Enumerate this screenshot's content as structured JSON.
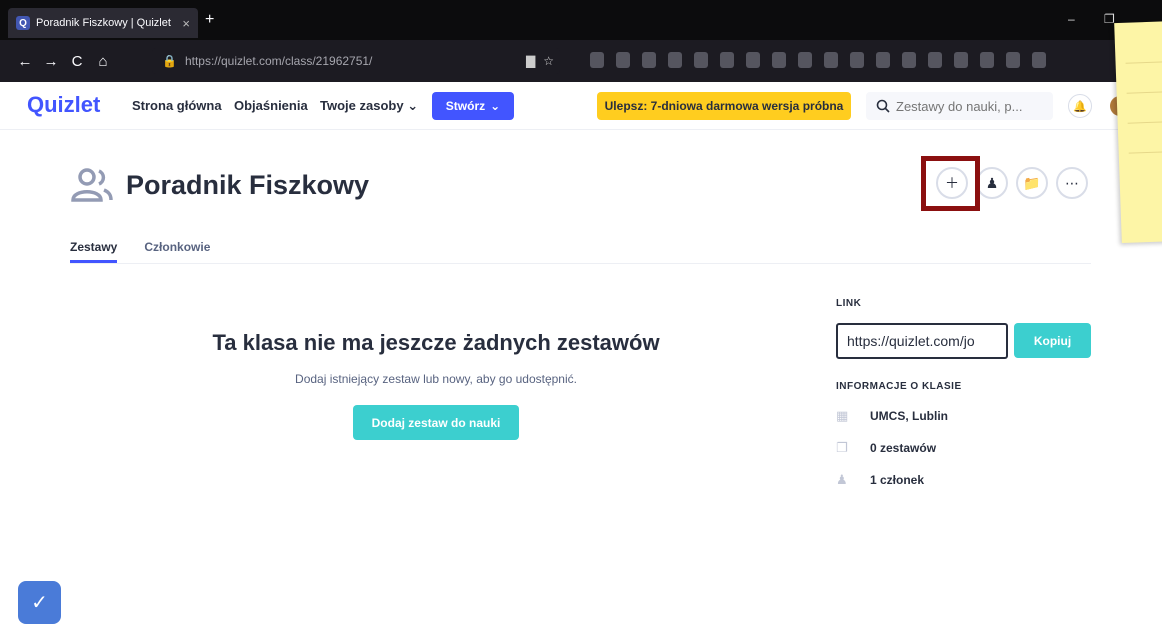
{
  "browser": {
    "tab_title": "Poradnik Fiszkowy | Quizlet",
    "favicon_letter": "Q",
    "tab_close": "×",
    "new_tab": "+",
    "url": "https://quizlet.com/class/21962751/",
    "back": "←",
    "forward": "→",
    "reload": "C",
    "home": "⌂",
    "minimize": "–",
    "restore": "❐"
  },
  "header": {
    "logo": "Quizlet",
    "nav": [
      "Strona główna",
      "Objaśnienia",
      "Twoje zasoby"
    ],
    "create_label": "Stwórz",
    "upgrade_label": "Ulepsz: 7-dniowa darmowa wersja próbna",
    "search_placeholder": "Zestawy do nauki, p..."
  },
  "page": {
    "class_title": "Poradnik Fiszkowy",
    "tabs": [
      "Zestawy",
      "Członkowie"
    ],
    "active_tab": "Zestawy",
    "empty_title": "Ta klasa nie ma jeszcze żadnych zestawów",
    "empty_subtitle": "Dodaj istniejący zestaw lub nowy, aby go udostępnić.",
    "add_set_button": "Dodaj zestaw do nauki"
  },
  "sidebar": {
    "link_label": "LINK",
    "link_value": "https://quizlet.com/jo",
    "copy_button": "Kopiuj",
    "info_label": "INFORMACJE O KLASIE",
    "school": "UMCS, Lublin",
    "sets_count": "0 zestawów",
    "members_count": "1 członek"
  },
  "colors": {
    "brand": "#4255ff",
    "upgrade": "#ffcd1f",
    "teal": "#3ccfcf",
    "highlight_box": "#8b0f0f"
  }
}
